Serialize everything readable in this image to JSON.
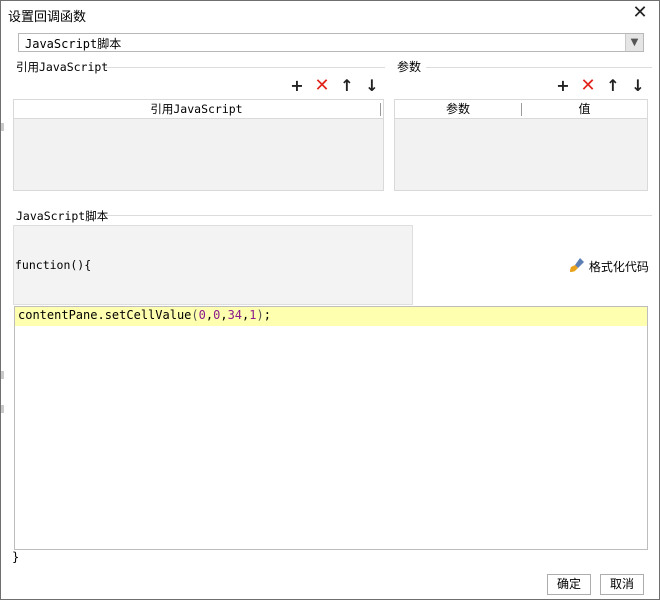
{
  "dialog": {
    "title": "设置回调函数"
  },
  "script_type": {
    "selected": "JavaScript脚本"
  },
  "reference_js": {
    "label": "引用JavaScript",
    "column": "引用JavaScript"
  },
  "params": {
    "label": "参数",
    "columns": [
      "参数",
      "值"
    ]
  },
  "toolbar": {
    "add": "+",
    "delete": "✕",
    "up": "↑",
    "down": "↓"
  },
  "js_script": {
    "label": "JavaScript脚本",
    "function_header": "function(){",
    "format_label": "格式化代码",
    "code_line": {
      "prefix": "contentPane.setCellValue",
      "open": "(",
      "a": "0",
      "b": "0",
      "c": "34",
      "d": "1",
      "close": ")",
      "end": ";",
      "comma": ","
    },
    "closing_brace": "}"
  },
  "buttons": {
    "ok": "确定",
    "cancel": "取消"
  }
}
